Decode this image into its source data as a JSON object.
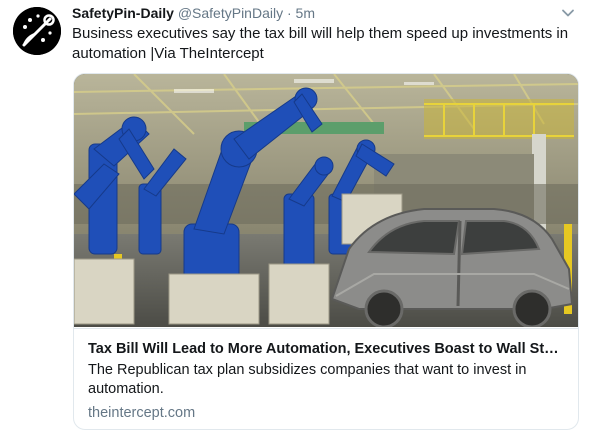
{
  "tweet": {
    "display_name": "SafetyPin-Daily",
    "handle": "@SafetyPinDaily",
    "separator": "·",
    "time": "5m",
    "text_line1": "Business executives say the tax bill will help them speed up investments in",
    "text_line2": "automation  |Via TheIntercept"
  },
  "card": {
    "title": "Tax Bill Will Lead to More Automation, Executives Boast to Wall Stree...",
    "description": "The Republican tax plan subsidizes companies that want to invest in automation.",
    "domain": "theintercept.com",
    "image_desc": "factory-robots-car-assembly"
  },
  "icons": {
    "menu": "chevron-down-icon",
    "avatar": "safety-pin-logo"
  },
  "colors": {
    "text": "#14171a",
    "secondary": "#657786",
    "border": "#e1e8ed",
    "robot_blue": "#1f4fb8"
  }
}
